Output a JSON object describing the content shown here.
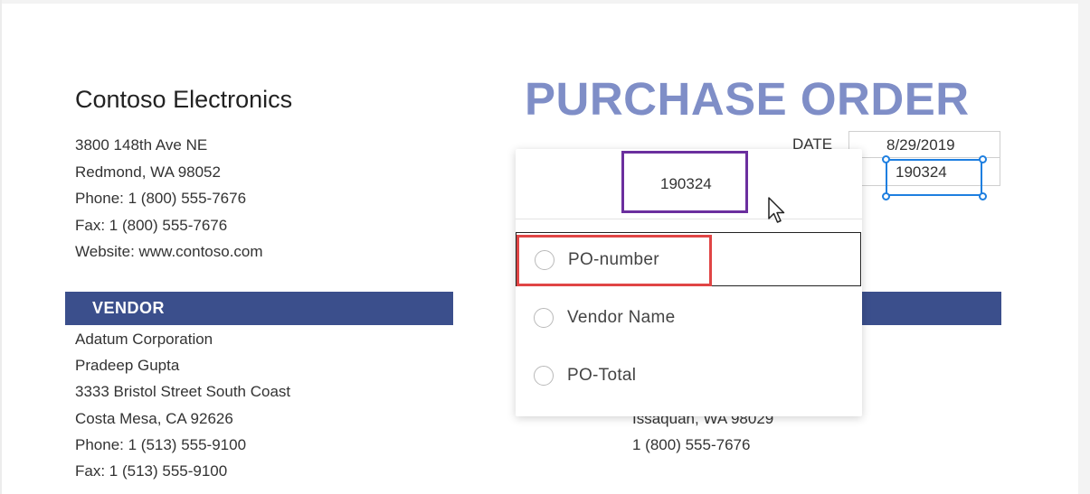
{
  "company": {
    "name": "Contoso Electronics",
    "address1": "3800 148th Ave NE",
    "address2": "Redmond, WA 98052",
    "phone": "Phone: 1 (800) 555-7676",
    "fax": "Fax: 1 (800) 555-7676",
    "website": "Website: www.contoso.com"
  },
  "document": {
    "title": "PURCHASE ORDER",
    "date_label": "DATE",
    "date_value": "8/29/2019",
    "po_value": "190324"
  },
  "vendor": {
    "header": "VENDOR",
    "lines": [
      "Adatum Corporation",
      "Pradeep Gupta",
      "3333 Bristol Street South Coast",
      "Costa Mesa, CA 92626",
      "Phone: 1 (513) 555-9100",
      "Fax: 1 (513) 555-9100"
    ]
  },
  "ship_to": {
    "lines": [
      "Issaquah, WA 98029",
      "1 (800) 555-7676"
    ]
  },
  "tag_popup": {
    "preview_value": "190324",
    "options": [
      {
        "label": "PO-number",
        "selected": false,
        "hovered": true
      },
      {
        "label": "Vendor Name",
        "selected": false
      },
      {
        "label": "PO-Total",
        "selected": false
      }
    ]
  },
  "colors": {
    "title": "#7f8ec7",
    "header_bar": "#3b4f8c",
    "selection": "#1e7fe0",
    "preview_outline": "#6b2f9e",
    "highlight_outline": "#e04545"
  },
  "icons": [
    "mouse-pointer-icon",
    "radio-icon"
  ]
}
